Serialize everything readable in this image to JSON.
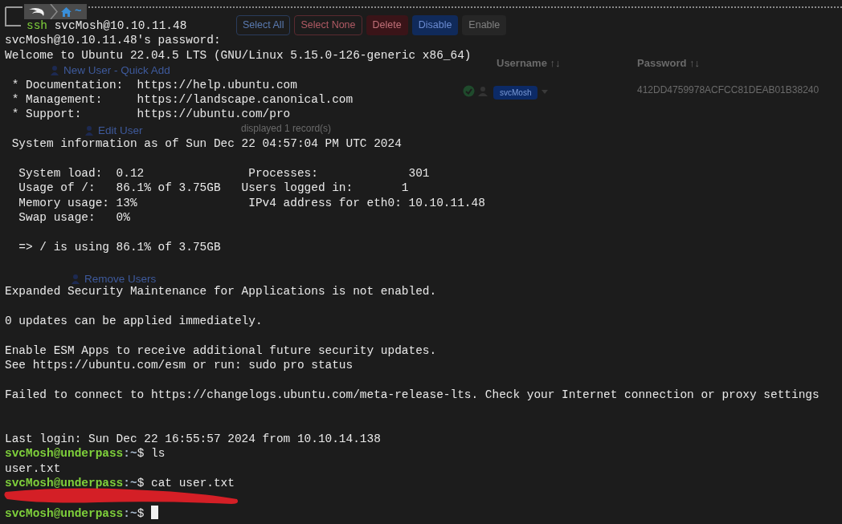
{
  "background_page": {
    "buttons": [
      {
        "label": "Select All",
        "kind": "outline-primary"
      },
      {
        "label": "Select None",
        "kind": "outline-danger"
      },
      {
        "label": "Delete",
        "kind": "danger"
      },
      {
        "label": "Disable",
        "kind": "primary"
      },
      {
        "label": "Enable",
        "kind": "dark"
      }
    ],
    "sidebar": [
      {
        "label": "New User - Quick Add"
      },
      {
        "label": "Edit User"
      },
      {
        "label": "Remove Users"
      }
    ],
    "table": {
      "columns": [
        "Username ↑↓",
        "Password ↑↓"
      ],
      "row": {
        "active": true,
        "username": "svcMosh",
        "password": "412DD4759978ACFCC81DEAB01B38240"
      },
      "footer": "displayed 1 record(s)"
    }
  },
  "prompt_header": {
    "path": "~"
  },
  "command": {
    "program": "ssh",
    "args": "svcMosh@10.10.11.48"
  },
  "lines": [
    {
      "kind": "text",
      "text": "svcMosh@10.10.11.48's password:"
    },
    {
      "kind": "text",
      "text": "Welcome to Ubuntu 22.04.5 LTS (GNU/Linux 5.15.0-126-generic x86_64)"
    },
    {
      "kind": "blank"
    },
    {
      "kind": "text",
      "text": " * Documentation:  https://help.ubuntu.com"
    },
    {
      "kind": "text",
      "text": " * Management:     https://landscape.canonical.com"
    },
    {
      "kind": "text",
      "text": " * Support:        https://ubuntu.com/pro"
    },
    {
      "kind": "blank"
    },
    {
      "kind": "text",
      "text": " System information as of Sun Dec 22 04:57:04 PM UTC 2024"
    },
    {
      "kind": "blank"
    },
    {
      "kind": "text",
      "text": "  System load:  0.12               Processes:             301"
    },
    {
      "kind": "text",
      "text": "  Usage of /:   86.1% of 3.75GB   Users logged in:       1"
    },
    {
      "kind": "text",
      "text": "  Memory usage: 13%                IPv4 address for eth0: 10.10.11.48"
    },
    {
      "kind": "text",
      "text": "  Swap usage:   0%"
    },
    {
      "kind": "blank"
    },
    {
      "kind": "text",
      "text": "  => / is using 86.1% of 3.75GB"
    },
    {
      "kind": "blank"
    },
    {
      "kind": "blank"
    },
    {
      "kind": "text",
      "text": "Expanded Security Maintenance for Applications is not enabled."
    },
    {
      "kind": "blank"
    },
    {
      "kind": "text",
      "text": "0 updates can be applied immediately."
    },
    {
      "kind": "blank"
    },
    {
      "kind": "text",
      "text": "Enable ESM Apps to receive additional future security updates."
    },
    {
      "kind": "text",
      "text": "See https://ubuntu.com/esm or run: sudo pro status"
    },
    {
      "kind": "blank"
    },
    {
      "kind": "text",
      "text": "Failed to connect to https://changelogs.ubuntu.com/meta-release-lts. Check your Internet connection or proxy settings"
    },
    {
      "kind": "blank"
    },
    {
      "kind": "blank"
    },
    {
      "kind": "text",
      "text": "Last login: Sun Dec 22 16:55:57 2024 from 10.10.14.138"
    },
    {
      "kind": "prompt",
      "user_host": "svcMosh@underpass",
      "path": ":~",
      "symbol": "$",
      "command": "ls"
    },
    {
      "kind": "text",
      "text": "user.txt"
    },
    {
      "kind": "prompt",
      "user_host": "svcMosh@underpass",
      "path": ":~",
      "symbol": "$",
      "command": "cat user.txt"
    },
    {
      "kind": "redacted"
    },
    {
      "kind": "prompt",
      "user_host": "svcMosh@underpass",
      "path": ":~",
      "symbol": "$",
      "cursor": true
    }
  ]
}
